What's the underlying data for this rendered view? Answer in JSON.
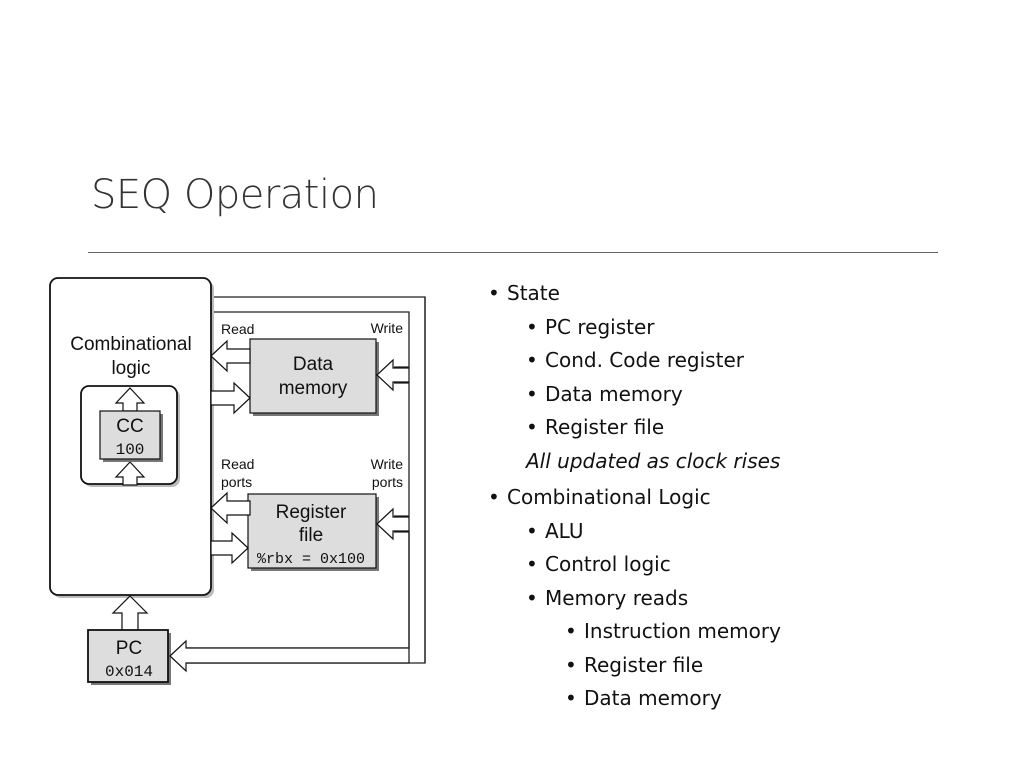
{
  "slide": {
    "title": "SEQ Operation"
  },
  "diagram": {
    "combinational_logic": "Combinational logic",
    "combinational_logic_line1": "Combinational",
    "combinational_logic_line2": "logic",
    "cc_label": "CC",
    "cc_value": "100",
    "data_memory_line1": "Data",
    "data_memory_line2": "memory",
    "register_file_line1": "Register",
    "register_file_line2": "file",
    "register_value": "%rbx = 0x100",
    "pc_label": "PC",
    "pc_value": "0x014",
    "read_label": "Read",
    "write_label": "Write",
    "read_ports_line1": "Read",
    "read_ports_line2": "ports",
    "write_ports_line1": "Write",
    "write_ports_line2": "ports"
  },
  "bullets": [
    {
      "level": 1,
      "text": "State"
    },
    {
      "level": 2,
      "text": "PC register"
    },
    {
      "level": 2,
      "text": "Cond. Code register"
    },
    {
      "level": 2,
      "text": "Data memory"
    },
    {
      "level": 2,
      "text": "Register file"
    },
    {
      "level": "note",
      "text": "All updated as clock rises"
    },
    {
      "level": 1,
      "text": "Combinational Logic"
    },
    {
      "level": 2,
      "text": "ALU"
    },
    {
      "level": 2,
      "text": "Control logic"
    },
    {
      "level": 2,
      "text": "Memory reads"
    },
    {
      "level": 3,
      "text": "Instruction memory"
    },
    {
      "level": 3,
      "text": "Register file"
    },
    {
      "level": 3,
      "text": "Data memory"
    }
  ]
}
